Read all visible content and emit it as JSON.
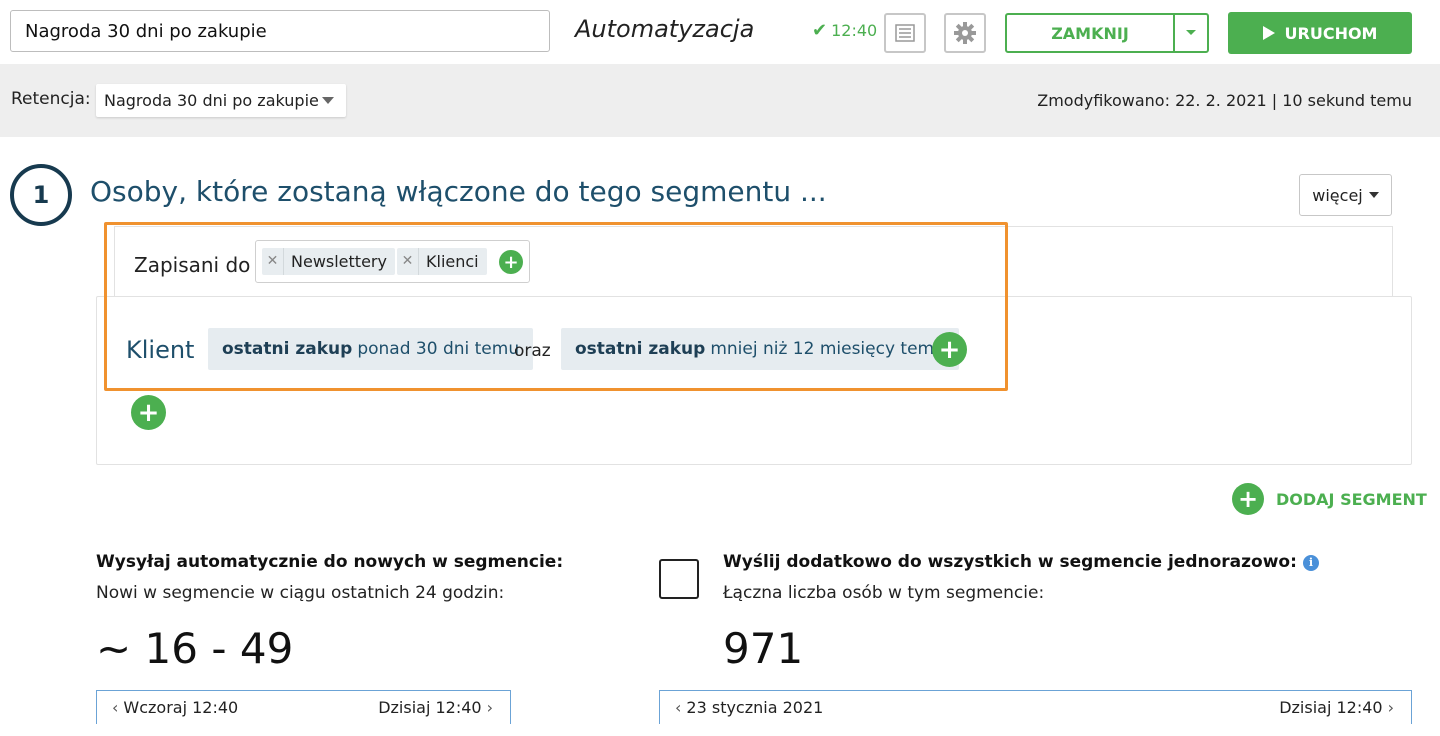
{
  "header": {
    "automation_name": "Nagroda 30 dni po zakupie",
    "app_title": "Automatyzacja",
    "saved_time": "12:40",
    "close_label": "ZAMKNIJ",
    "run_label": "URUCHOM"
  },
  "retention": {
    "label": "Retencja:",
    "selected": "Nagroda 30 dni po zakupie",
    "modified": "Zmodyfikowano: 22. 2. 2021 | 10 sekund temu"
  },
  "segment": {
    "step": "1",
    "title": "Osoby, które zostaną włączone do tego segmentu ...",
    "more_label": "więcej",
    "subscribed_label": "Zapisani do",
    "tags": [
      "Newslettery",
      "Klienci"
    ],
    "client_label": "Klient",
    "conditions": [
      {
        "bold": "ostatni zakup",
        "rest": "ponad 30 dni temu"
      },
      {
        "bold": "ostatni zakup",
        "rest": "mniej niż 12 miesięcy temu"
      }
    ],
    "and_label": "oraz",
    "add_segment_label": "DODAJ SEGMENT"
  },
  "auto_send": {
    "title": "Wysyłaj automatycznie do nowych w segmencie:",
    "subtitle": "Nowi w segmencie w ciągu ostatnich 24 godzin:",
    "count": "~ 16 - 49",
    "range_from": "Wczoraj 12:40",
    "range_to": "Dzisiaj 12:40"
  },
  "one_time": {
    "title": "Wyślij dodatkowo do wszystkich w segmencie jednorazowo:",
    "subtitle": "Łączna liczba osób w tym segmencie:",
    "count": "971",
    "range_from": "23 stycznia 2021",
    "range_to": "Dzisiaj 12:40",
    "checked": false
  },
  "colors": {
    "green": "#4caf50",
    "navy": "#1e4f6b",
    "highlight": "#f0922f",
    "info": "#4a90d9"
  }
}
